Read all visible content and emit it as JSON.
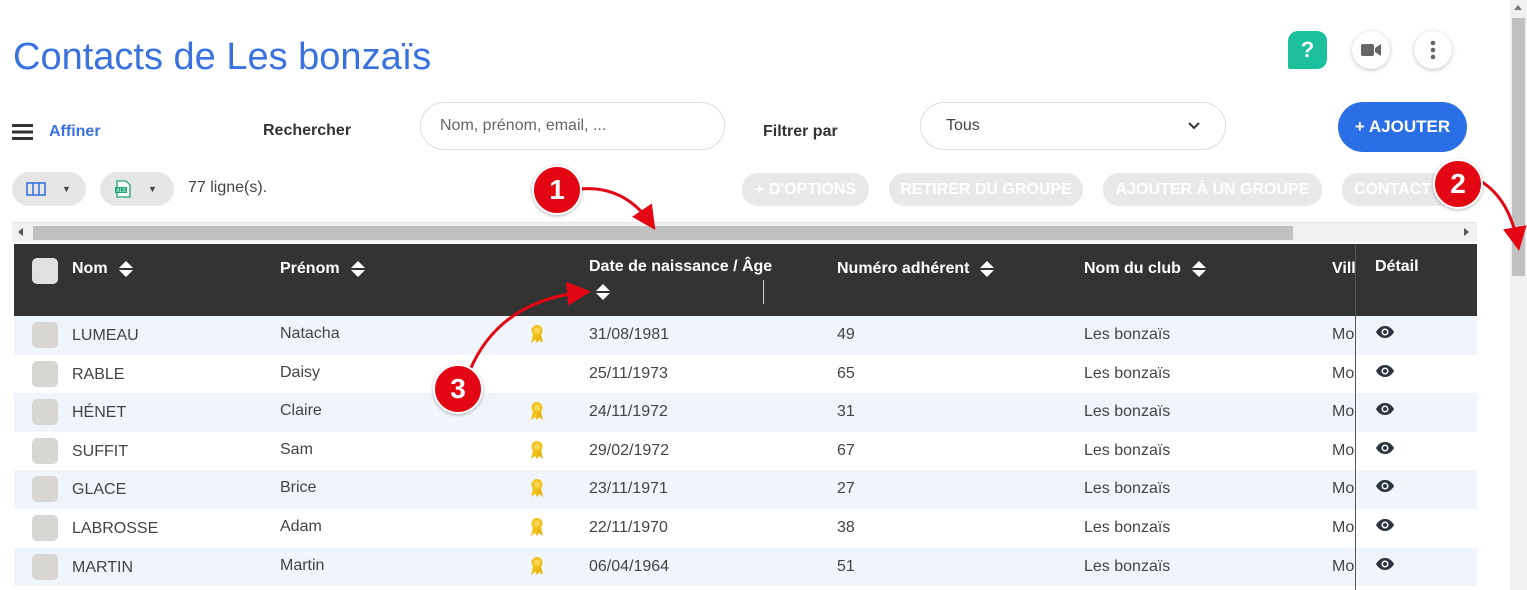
{
  "header": {
    "title": "Contacts de Les bonzaïs",
    "help_label": "?"
  },
  "filters": {
    "affiner_label": "Affiner",
    "search_label": "Rechercher",
    "search_placeholder": "Nom, prénom, email, ...",
    "filter_label": "Filtrer par",
    "filter_value": "Tous",
    "add_label": "+ AJOUTER"
  },
  "toolbar": {
    "row_count": "77 ligne(s).",
    "actions": [
      "+ D'OPTIONS",
      "RETIRER DU GROUPE",
      "AJOUTER À UN GROUPE",
      "CONTACT"
    ]
  },
  "table": {
    "headers": {
      "nom": "Nom",
      "prenom": "Prénom",
      "date": "Date de naissance / Âge",
      "numero": "Numéro adhérent",
      "club": "Nom du club",
      "ville": "Vill",
      "detail": "Détail"
    },
    "rows": [
      {
        "nom": "LUMEAU",
        "prenom": "Natacha",
        "badge": true,
        "date": "31/08/1981",
        "numero": "49",
        "club": "Les bonzaïs",
        "ville": "Mo"
      },
      {
        "nom": "RABLE",
        "prenom": "Daisy",
        "badge": false,
        "date": "25/11/1973",
        "numero": "65",
        "club": "Les bonzaïs",
        "ville": "Mo"
      },
      {
        "nom": "HÉNET",
        "prenom": "Claire",
        "badge": true,
        "date": "24/11/1972",
        "numero": "31",
        "club": "Les bonzaïs",
        "ville": "Mo"
      },
      {
        "nom": "SUFFIT",
        "prenom": "Sam",
        "badge": true,
        "date": "29/02/1972",
        "numero": "67",
        "club": "Les bonzaïs",
        "ville": "Mo"
      },
      {
        "nom": "GLACE",
        "prenom": "Brice",
        "badge": true,
        "date": "23/11/1971",
        "numero": "27",
        "club": "Les bonzaïs",
        "ville": "Mo"
      },
      {
        "nom": "LABROSSE",
        "prenom": "Adam",
        "badge": true,
        "date": "22/11/1970",
        "numero": "38",
        "club": "Les bonzaïs",
        "ville": "Mo"
      },
      {
        "nom": "MARTIN",
        "prenom": "Martin",
        "badge": true,
        "date": "06/04/1964",
        "numero": "51",
        "club": "Les bonzaïs",
        "ville": "Mo"
      }
    ]
  },
  "annotations": [
    "1",
    "2",
    "3"
  ],
  "colors": {
    "accent": "#3a72e0",
    "add_button": "#2b6fe6",
    "help": "#1cc09d",
    "header_bg": "#333333",
    "row_alt": "#eff5fb",
    "annotation": "#e30613",
    "badge": "#f2c21b"
  }
}
